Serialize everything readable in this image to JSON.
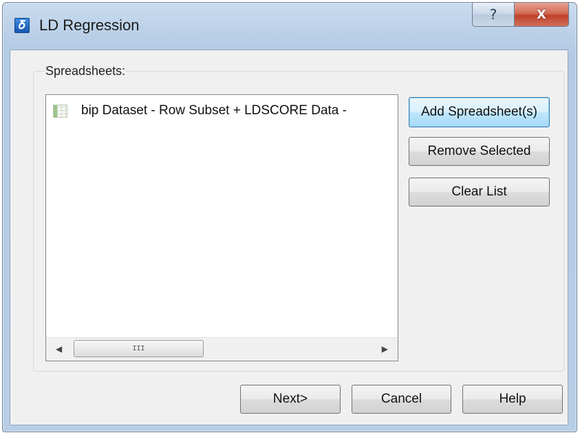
{
  "window": {
    "title": "LD Regression",
    "app_icon": "app-logo-icon",
    "help_glyph": "?",
    "close_glyph": "X"
  },
  "group": {
    "label": "Spreadsheets:"
  },
  "list": {
    "items": [
      {
        "label": "bip Dataset - Row Subset + LDSCORE Data -",
        "icon": "spreadsheet-icon"
      }
    ],
    "scrollbar_thumb_grip": "III"
  },
  "side_buttons": {
    "add": "Add Spreadsheet(s)",
    "remove": "Remove Selected",
    "clear": "Clear List"
  },
  "footer_buttons": {
    "next": "Next>",
    "cancel": "Cancel",
    "help": "Help"
  }
}
